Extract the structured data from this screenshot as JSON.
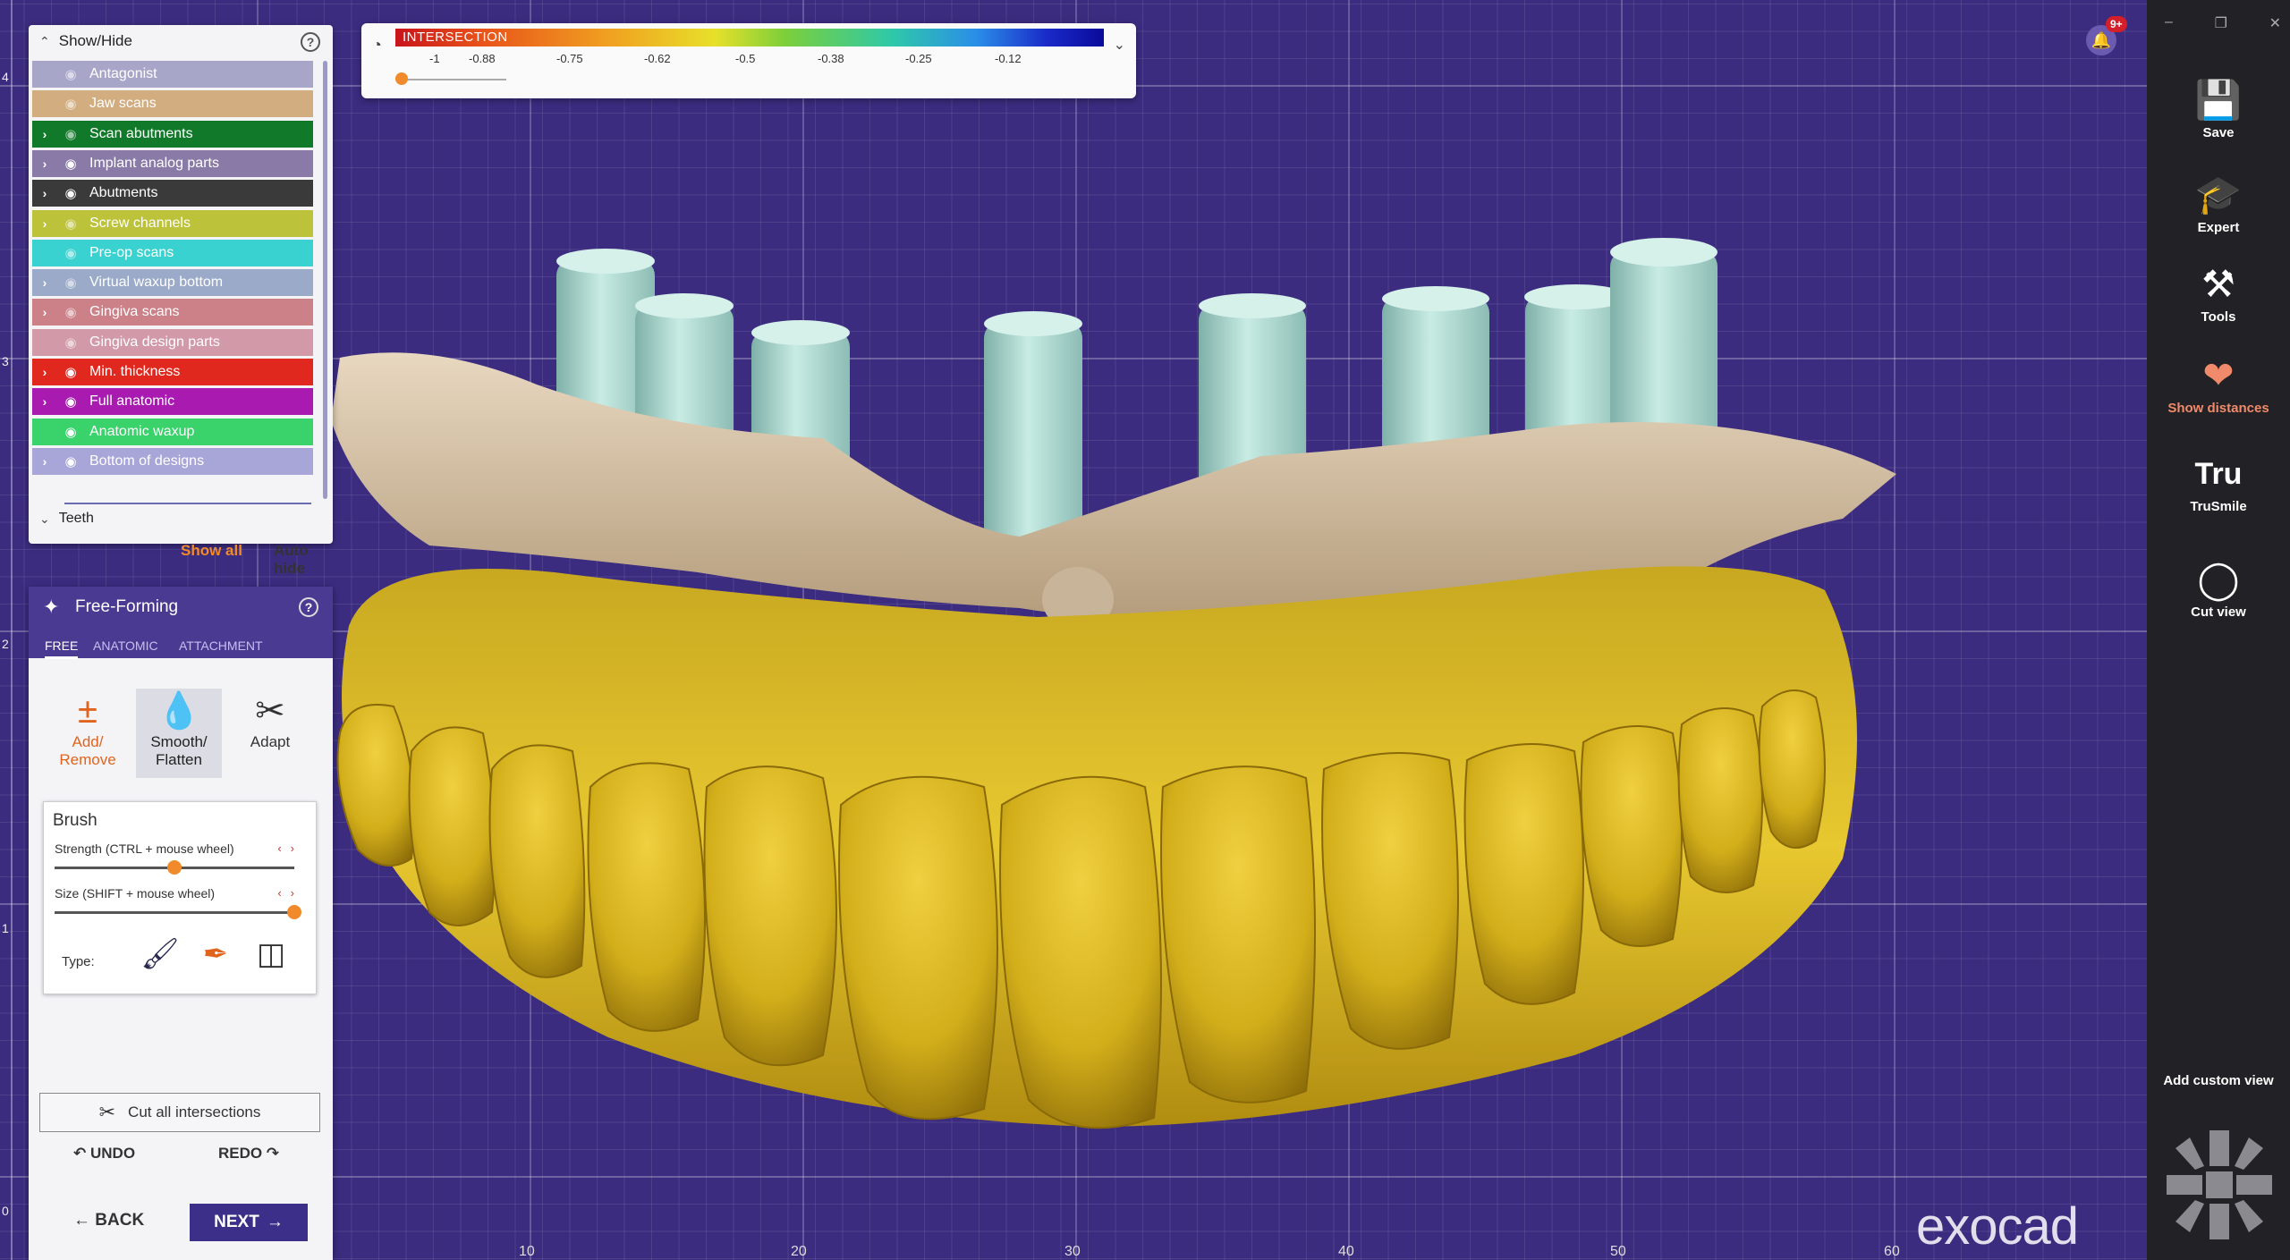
{
  "colors": {
    "accent": "#f08a2a",
    "panel_header": "#4a3a92",
    "next_button": "#3b2f8a",
    "viewport": "#3c2c80",
    "rightbar": "#222226"
  },
  "showhide": {
    "title": "Show/Hide",
    "layers": [
      {
        "label": "Antagonist",
        "color": "#a8a6c8",
        "expandable": false,
        "visible": false
      },
      {
        "label": "Jaw scans",
        "color": "#d2ad80",
        "expandable": false,
        "visible": false
      },
      {
        "label": "Scan abutments",
        "color": "#117a2a",
        "expandable": true,
        "visible": false
      },
      {
        "label": "Implant analog parts",
        "color": "#8a7aa8",
        "expandable": true,
        "visible": true
      },
      {
        "label": "Abutments",
        "color": "#3a3a3a",
        "expandable": true,
        "visible": true
      },
      {
        "label": "Screw channels",
        "color": "#bcc23a",
        "expandable": true,
        "visible": false
      },
      {
        "label": "Pre-op scans",
        "color": "#3ad2d0",
        "expandable": false,
        "visible": false
      },
      {
        "label": "Virtual waxup bottom",
        "color": "#9aaac8",
        "expandable": true,
        "visible": false
      },
      {
        "label": "Gingiva scans",
        "color": "#cc8088",
        "expandable": true,
        "visible": false
      },
      {
        "label": "Gingiva design parts",
        "color": "#d29aa8",
        "expandable": false,
        "visible": false
      },
      {
        "label": "Min. thickness",
        "color": "#e0281e",
        "expandable": true,
        "visible": true
      },
      {
        "label": "Full anatomic",
        "color": "#a81ab0",
        "expandable": true,
        "visible": true
      },
      {
        "label": "Anatomic waxup",
        "color": "#3ad26a",
        "expandable": false,
        "visible": true
      },
      {
        "label": "Bottom of designs",
        "color": "#a8a6d8",
        "expandable": true,
        "visible": true
      }
    ],
    "teeth_label": "Teeth",
    "show_all": "Show all",
    "auto_hide": "Auto hide"
  },
  "freeform": {
    "title": "Free-Forming",
    "tabs": [
      "FREE",
      "ANATOMIC",
      "ATTACHMENT"
    ],
    "active_tab": "FREE",
    "tools": [
      {
        "label": "Add/\nRemove",
        "icon": "plus-minus-icon",
        "selected": false
      },
      {
        "label": "Smooth/\nFlatten",
        "icon": "drop-icon",
        "selected": true
      },
      {
        "label": "Adapt",
        "icon": "adapt-icon",
        "selected": false
      }
    ],
    "brush": {
      "title": "Brush",
      "strength_label": "Strength (CTRL + mouse wheel)",
      "strength_value": 0.5,
      "size_label": "Size (SHIFT + mouse wheel)",
      "size_value": 1.0,
      "type_label": "Type:",
      "types": [
        "wide-brush-icon",
        "fine-brush-icon",
        "cylinder-icon"
      ]
    },
    "cut_all": "Cut all intersections",
    "undo": "UNDO",
    "redo": "REDO",
    "back": "BACK",
    "next": "NEXT"
  },
  "colorscale": {
    "title": "INTERSECTION",
    "ticks": [
      "-1",
      "-0.88",
      "-0.75",
      "-0.62",
      "-0.5",
      "-0.38",
      "-0.25",
      "-0.12"
    ],
    "slider_value": 0
  },
  "notifications": {
    "badge": "9+"
  },
  "rightbar": {
    "items": [
      {
        "label": "Save",
        "icon": "save-icon",
        "accent": false
      },
      {
        "label": "Expert",
        "icon": "graduation-cap-icon",
        "accent": false
      },
      {
        "label": "Tools",
        "icon": "tools-icon",
        "accent": false
      },
      {
        "label": "Show distances",
        "icon": "show-distances-icon",
        "accent": true
      },
      {
        "label": "TruSmile",
        "icon": "trusmile-icon",
        "accent": false
      },
      {
        "label": "Cut view",
        "icon": "cut-view-icon",
        "accent": false
      }
    ],
    "add_custom_view": "Add custom view"
  },
  "rulers": {
    "left": [
      "4",
      "3",
      "2",
      "1",
      "0"
    ],
    "bottom": [
      "10",
      "20",
      "30",
      "40",
      "50",
      "60"
    ]
  },
  "logo": "exocad"
}
